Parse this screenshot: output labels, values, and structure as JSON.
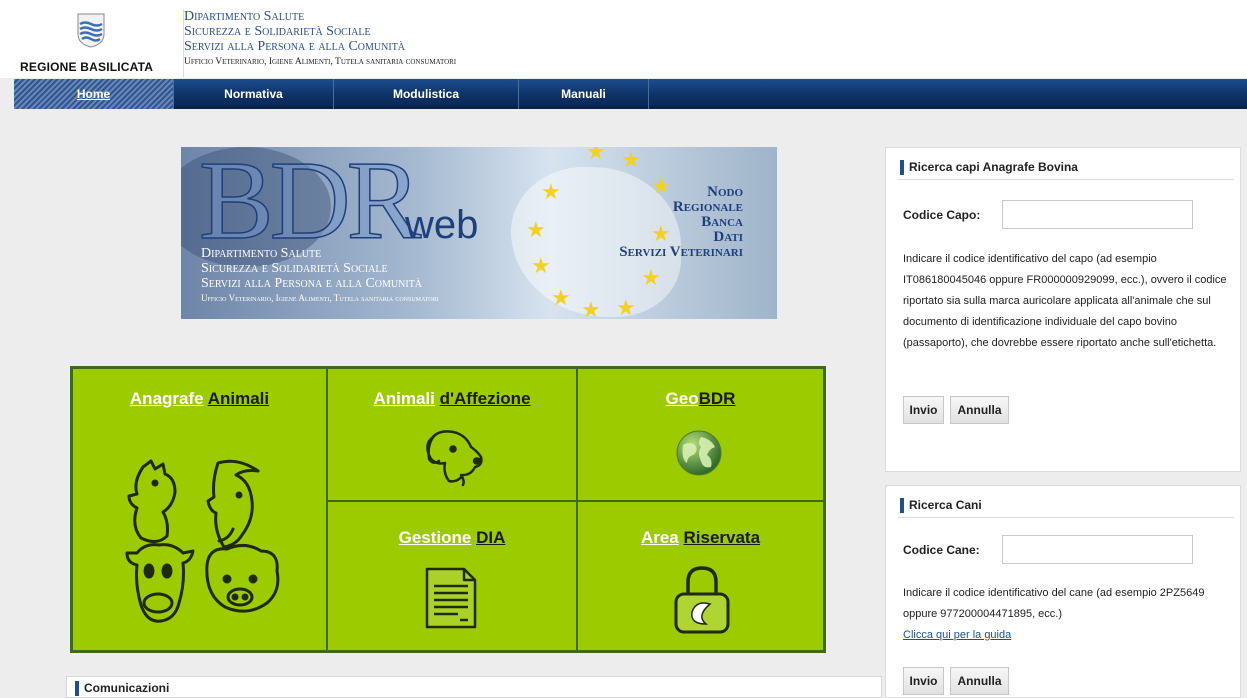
{
  "header": {
    "region_name": "REGIONE BASILICATA",
    "dept_lines": [
      "Dipartimento Salute",
      "Sicurezza e Solidarietà Sociale",
      "Servizi alla Persona e alla Comunità"
    ],
    "dept_sub": "Ufficio Veterinario, Igiene Alimenti, Tutela sanitaria consumatori"
  },
  "nav": {
    "items": [
      {
        "label": "Home",
        "active": true
      },
      {
        "label": "Normativa",
        "active": false
      },
      {
        "label": "Modulistica",
        "active": false
      },
      {
        "label": "Manuali",
        "active": false
      }
    ]
  },
  "banner": {
    "logo_big": "BDR",
    "logo_small": "web",
    "dept_lines": [
      "Dipartimento Salute",
      "Sicurezza e Solidarietà Sociale",
      "Servizi alla Persona e alla Comunità"
    ],
    "dept_sub": "Ufficio Veterinario, Igiene Alimenti, Tutela sanitaria consumatori",
    "nodo_lines": [
      "Nodo",
      "Regionale",
      "Banca",
      "Dati",
      "Servizi Veterinari"
    ]
  },
  "tiles": {
    "anagrafe": {
      "w1": "Anagrafe",
      "w2": "Animali"
    },
    "affezione": {
      "w1": "Animali",
      "w2": "d'Affezione"
    },
    "geobdr": {
      "w1": "Geo",
      "w2": "BDR"
    },
    "dia": {
      "w1": "Gestione",
      "w2": "DIA"
    },
    "riservata": {
      "w1": "Area",
      "w2": "Riservata"
    }
  },
  "comunicazioni": {
    "title": "Comunicazioni"
  },
  "bovina": {
    "title": "Ricerca capi Anagrafe Bovina",
    "field_label": "Codice Capo:",
    "field_value": "",
    "help": "Indicare il codice identificativo del capo (ad esempio IT086180045046 oppure FR000000929099, ecc.), ovvero il codice riportato sia sulla marca auricolare applicata all'animale che sul documento di identificazione individuale del capo bovino (passaporto), che dovrebbe essere riportato anche sull'etichetta.",
    "submit": "Invio",
    "cancel": "Annulla"
  },
  "cani": {
    "title": "Ricerca Cani",
    "field_label": "Codice Cane:",
    "field_value": "",
    "help": "Indicare il codice identificativo del cane (ad esempio 2PZ5649 oppure 977200004471895, ecc.)",
    "guide_link": "Clicca qui per la guida",
    "submit": "Invio",
    "cancel": "Annulla"
  },
  "colors": {
    "nav_blue": "#0e3366",
    "tile_green": "#9ccb00",
    "tile_border": "#3f6a1a",
    "dept_blue": "#2a4f8f"
  }
}
